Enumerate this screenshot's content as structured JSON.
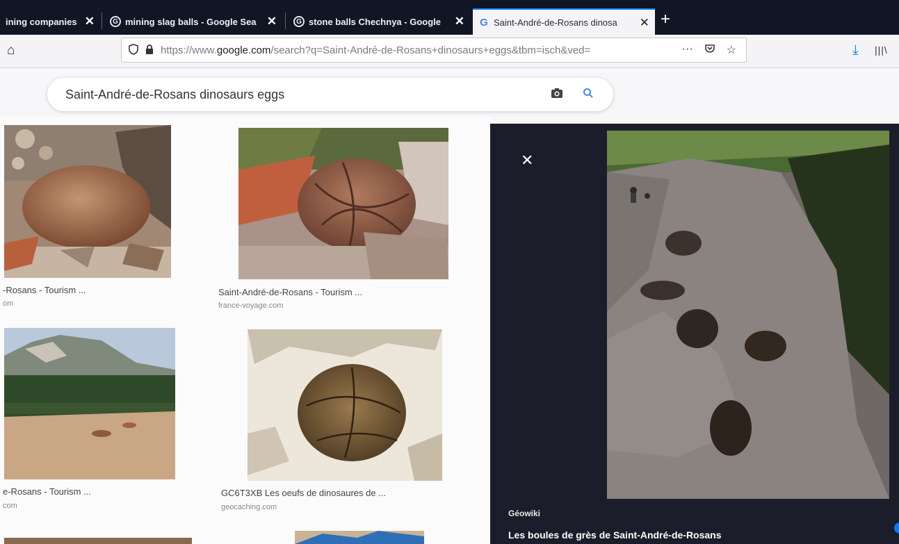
{
  "browser": {
    "tabs": [
      {
        "title": "ining companies",
        "active": false
      },
      {
        "title": "mining slag balls - Google Sea",
        "active": false
      },
      {
        "title": "stone balls Chechnya - Google",
        "active": false
      },
      {
        "title": "Saint-André-de-Rosans dinosa",
        "active": true
      }
    ],
    "url_prefix": "https://www.",
    "url_domain": "google.com",
    "url_rest": "/search?q=Saint-André-de-Rosans+dinosaurs+eggs&tbm=isch&ved=",
    "more_label": "···",
    "new_tab": "+",
    "close_glyph": "✕"
  },
  "search": {
    "query": "Saint-André-de-Rosans dinosaurs eggs"
  },
  "results": [
    {
      "caption": "-Rosans - Tourism ...",
      "source": "om"
    },
    {
      "caption": "Saint-André-de-Rosans - Tourism ...",
      "source": "france-voyage.com"
    },
    {
      "caption": "e-Rosans - Tourism ...",
      "source": "com"
    },
    {
      "caption": "GC6T3XB Les oeufs de dinosaures de ...",
      "source": "geocaching.com"
    }
  ],
  "preview": {
    "source": "Géowiki",
    "title": "Les boules de grès de Saint-André-de-Rosans",
    "close_glyph": "✕"
  },
  "colors": {
    "tabbar": "#101624",
    "accent": "#0a84ff",
    "google_blue": "#4285f4",
    "panel": "#1b1d2b"
  }
}
